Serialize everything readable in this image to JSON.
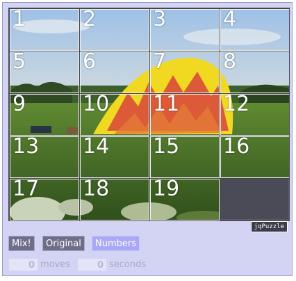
{
  "puzzle": {
    "tiles": [
      "1",
      "2",
      "3",
      "4",
      "5",
      "6",
      "7",
      "8",
      "9",
      "10",
      "11",
      "12",
      "13",
      "14",
      "15",
      "16",
      "17",
      "18",
      "19"
    ],
    "brand": "jqPuzzle"
  },
  "controls": {
    "mix_label": "Mix!",
    "original_label": "Original",
    "numbers_label": "Numbers"
  },
  "status": {
    "moves_value": "0",
    "moves_label": "moves",
    "seconds_value": "0",
    "seconds_label": "seconds"
  },
  "colors": {
    "background": "#d3d4f3",
    "button": "#6e6e8a",
    "button_active": "#a9a8f4",
    "empty_slot": "#4b4b57"
  },
  "icons": {
    "image": "hot-air-balloon-photo"
  }
}
